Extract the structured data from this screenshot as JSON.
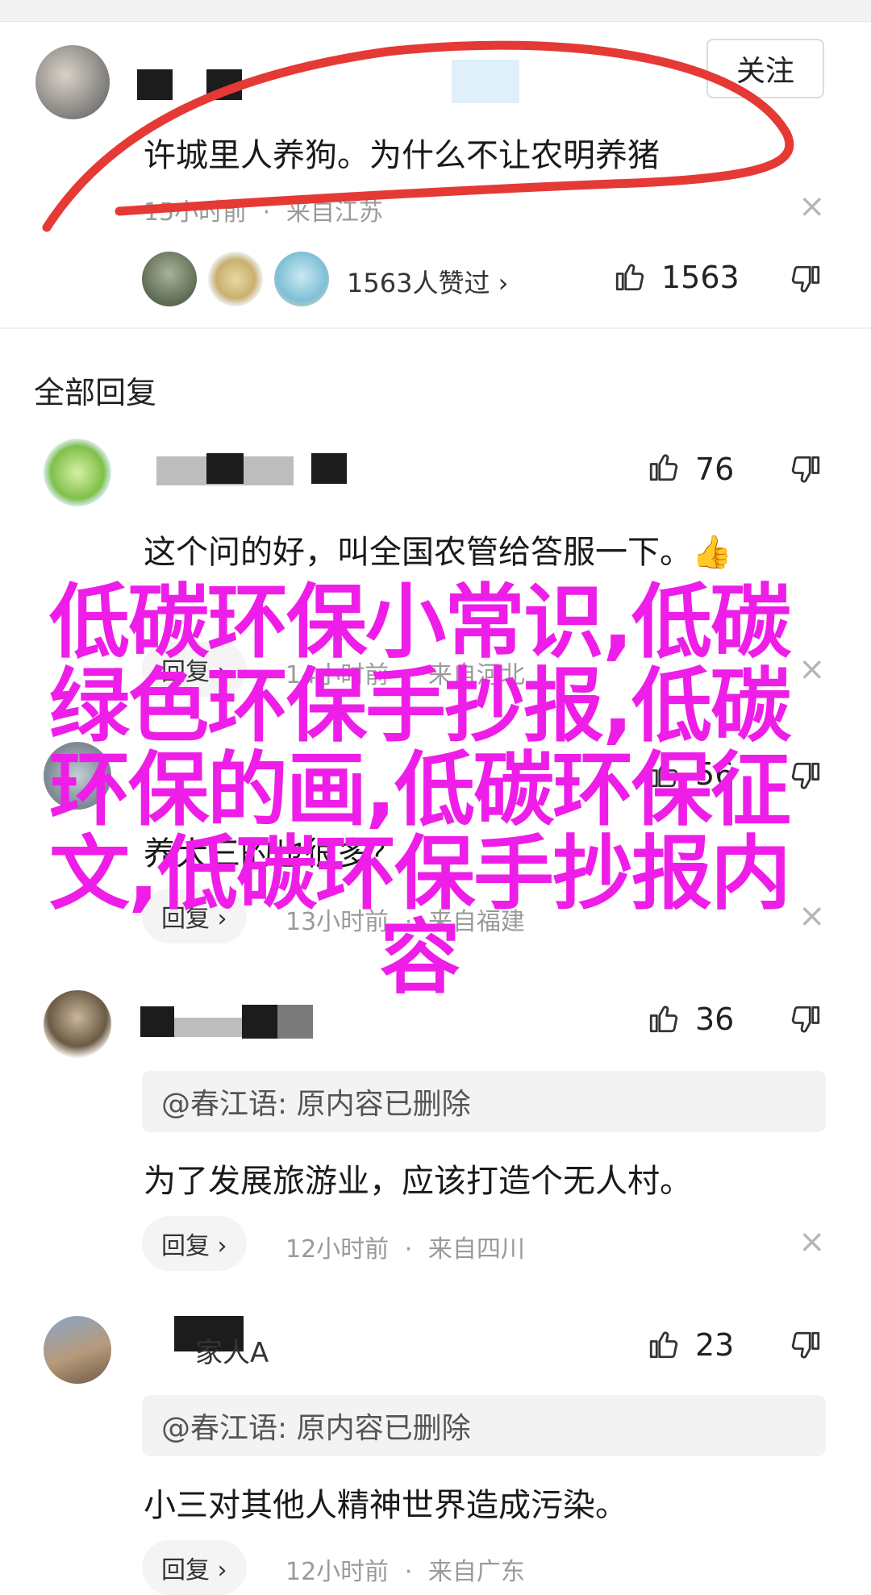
{
  "main_comment": {
    "follow_label": "关注",
    "text": "许城里人养狗。为什么不让农明养猪",
    "time": "15小时前",
    "separator": "·",
    "location": "来自江苏",
    "close_symbol": "×",
    "likes_summary": "1563人赞过 ›",
    "like_count": "1563"
  },
  "replies_section": {
    "title": "全部回复"
  },
  "replies": [
    {
      "like_count": "76",
      "text": "这个问的好，叫全国农管给答服一下。👍",
      "reply_label": "回复 ›",
      "time": "14小时前",
      "location": "来自河北",
      "separator": "·"
    },
    {
      "like_count": "56",
      "text": "养大三的也很多？",
      "reply_label": "回复 ›",
      "time": "13小时前",
      "location": "来自福建",
      "separator": "·"
    },
    {
      "like_count": "36",
      "quote": "@春江语: 原内容已删除",
      "text": "为了发展旅游业，应该打造个无人村。",
      "reply_label": "回复 ›",
      "time": "12小时前",
      "location": "来自四川",
      "separator": "·"
    },
    {
      "name": "家人A",
      "like_count": "23",
      "quote": "@春江语: 原内容已删除",
      "text": "小三对其他人精神世界造成污染。",
      "reply_label": "回复 ›",
      "time": "12小时前",
      "location": "来自广东",
      "separator": "·"
    }
  ],
  "overlay_text": {
    "line1": "低碳环保小常识,低碳",
    "line2": "绿色环保手抄报,低碳",
    "line3": "环保的画,低碳环保征",
    "line4": "文,低碳环保手抄报内",
    "line5": "容"
  },
  "colors": {
    "overlay": "#ee1ee8",
    "annotation_circle": "#e53935",
    "meta_text": "#9a9a9a"
  },
  "icons": [
    "thumbs-up-icon",
    "thumbs-down-icon",
    "close-icon",
    "chevron-right-icon"
  ]
}
